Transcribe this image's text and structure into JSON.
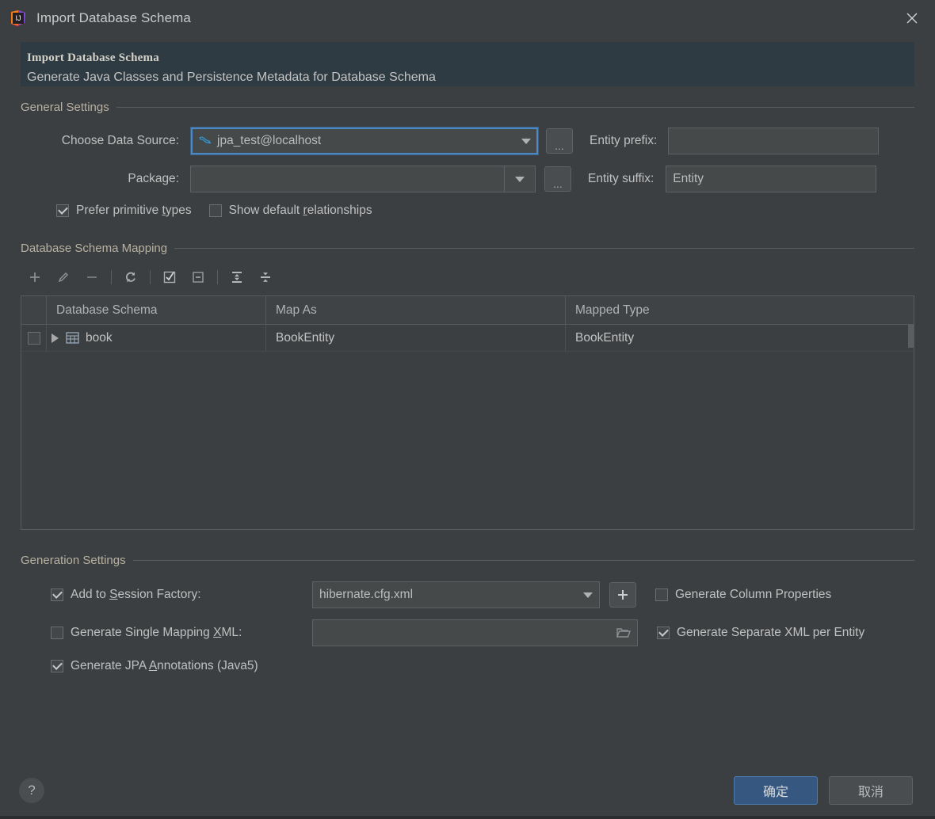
{
  "window": {
    "title": "Import Database Schema",
    "logo_icon": "intellij-idea-logo",
    "close_icon": "close-icon"
  },
  "banner": {
    "title": "Import Database Schema",
    "subtitle": "Generate Java Classes and Persistence Metadata for Database Schema"
  },
  "general_settings": {
    "group_label": "General Settings",
    "data_source": {
      "label": "Choose Data Source:",
      "value": "jpa_test@localhost",
      "icon": "mysql-dolphin-icon",
      "focused": true,
      "browse_label": "..."
    },
    "package": {
      "label": "Package:",
      "value": "",
      "browse_label": "..."
    },
    "entity_prefix": {
      "label": "Entity prefix:",
      "value": ""
    },
    "entity_suffix": {
      "label": "Entity suffix:",
      "value": "Entity"
    },
    "prefer_primitive_types": {
      "label_before": "Prefer primitive ",
      "mnemonic": "t",
      "label_after": "ypes",
      "checked": true
    },
    "show_default_relationships": {
      "label_before": "Show default ",
      "mnemonic": "r",
      "label_after": "elationships",
      "checked": false
    }
  },
  "schema_mapping": {
    "group_label": "Database Schema Mapping",
    "toolbar": [
      {
        "name": "add-icon",
        "glyph": "+"
      },
      {
        "name": "edit-pencil-icon",
        "glyph": "✎"
      },
      {
        "name": "remove-icon",
        "glyph": "−"
      },
      {
        "name": "refresh-icon",
        "glyph": "⟳"
      },
      {
        "name": "select-all-icon",
        "glyph": "☑"
      },
      {
        "name": "deselect-all-icon",
        "glyph": "⊟"
      },
      {
        "name": "expand-all-icon",
        "glyph": "⤓"
      },
      {
        "name": "collapse-all-icon",
        "glyph": "⤒"
      }
    ],
    "columns": [
      "Database Schema",
      "Map As",
      "Mapped Type"
    ],
    "rows": [
      {
        "checked": false,
        "expanded": false,
        "icon": "database-table-icon",
        "schema": "book",
        "map_as": "BookEntity",
        "mapped_type": "BookEntity"
      }
    ]
  },
  "generation_settings": {
    "group_label": "Generation Settings",
    "add_to_session_factory": {
      "label_before": "Add to ",
      "mnemonic": "S",
      "label_after": "ession Factory:",
      "checked": true,
      "value": "hibernate.cfg.xml",
      "add_button_label": "+",
      "add_button_icon": "plus-icon"
    },
    "generate_single_mapping_xml": {
      "label_before": "Generate Single Mapping ",
      "mnemonic": "X",
      "label_after": "ML:",
      "checked": false,
      "value": "",
      "browse_icon": "folder-icon"
    },
    "generate_jpa_annotations": {
      "label_before": "Generate JPA ",
      "mnemonic": "A",
      "label_after": "nnotations (Java5)",
      "checked": true
    },
    "generate_column_properties": {
      "label": "Generate Column Properties",
      "checked": false
    },
    "generate_separate_xml_per_entity": {
      "label": "Generate Separate XML per Entity",
      "checked": true
    }
  },
  "footer": {
    "help_label": "?",
    "ok_label": "确定",
    "cancel_label": "取消"
  },
  "colors": {
    "background": "#3c3f41",
    "banner": "#2f3b43",
    "accent": "#4a88c7",
    "primary_button": "#365880",
    "text": "#bbbbbb"
  }
}
